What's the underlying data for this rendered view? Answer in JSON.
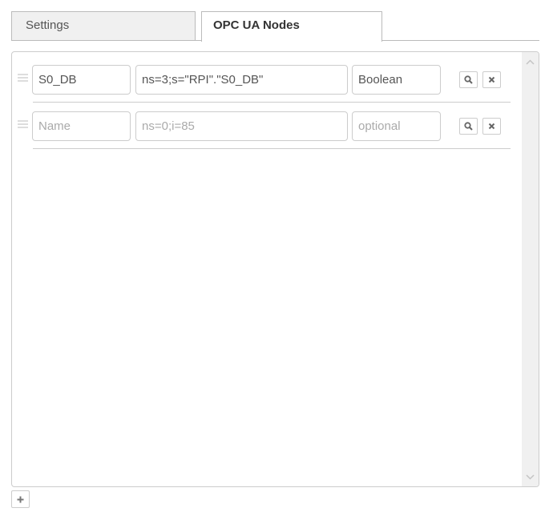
{
  "tabs": [
    {
      "label": "Settings",
      "active": false
    },
    {
      "label": "OPC UA Nodes",
      "active": true
    }
  ],
  "nodes": [
    {
      "name": {
        "value": "S0_DB",
        "placeholder": "Name"
      },
      "node_id": {
        "value": "ns=3;s=\"RPI\".\"S0_DB\"",
        "placeholder": "ns=0;i=85"
      },
      "data_type": {
        "value": "Boolean",
        "placeholder": "optional"
      },
      "actions": {
        "search_icon": "search-icon",
        "remove_icon": "close-icon"
      }
    },
    {
      "name": {
        "value": "",
        "placeholder": "Name"
      },
      "node_id": {
        "value": "",
        "placeholder": "ns=0;i=85"
      },
      "data_type": {
        "value": "",
        "placeholder": "optional"
      },
      "actions": {
        "search_icon": "search-icon",
        "remove_icon": "close-icon"
      }
    }
  ],
  "add_button": {
    "icon": "plus-icon"
  },
  "colors": {
    "border": "#cccccc",
    "tab_inactive_bg": "#f0f0f0",
    "scrollbar_bg": "#f0f0f0",
    "placeholder": "#aaaaaa",
    "text": "#555555"
  }
}
